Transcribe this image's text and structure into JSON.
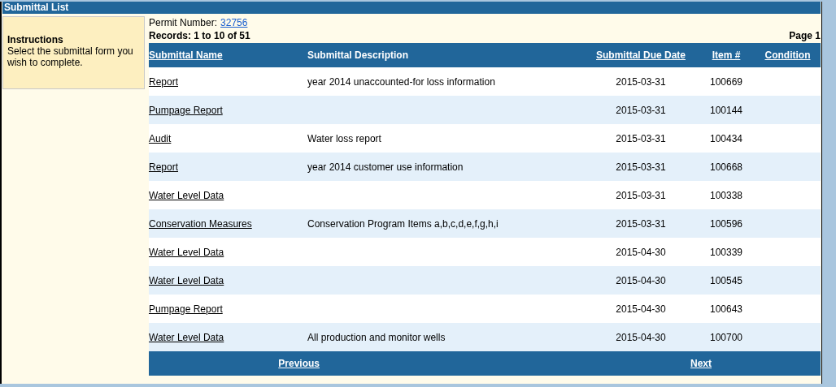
{
  "panel": {
    "title": "Submittal List"
  },
  "instructions": {
    "heading": "Instructions",
    "text": "Select the submittal form you wish to complete."
  },
  "permit": {
    "label": "Permit Number:",
    "number": "32756"
  },
  "records": "Records: 1 to 10 of 51",
  "page": "Page 1",
  "table": {
    "columns": [
      "Submittal Name",
      "Submittal Description",
      "Submittal Due Date",
      "Item #",
      "Condition"
    ],
    "rows": [
      {
        "name": "Report",
        "description": "year 2014 unaccounted-for loss information",
        "due_date": "2015-03-31",
        "item": "100669"
      },
      {
        "name": "Pumpage Report",
        "description": "",
        "due_date": "2015-03-31",
        "item": "100144"
      },
      {
        "name": "Audit",
        "description": "Water loss report",
        "due_date": "2015-03-31",
        "item": "100434"
      },
      {
        "name": "Report",
        "description": "year 2014 customer use information",
        "due_date": "2015-03-31",
        "item": "100668"
      },
      {
        "name": "Water Level Data",
        "description": "",
        "due_date": "2015-03-31",
        "item": "100338"
      },
      {
        "name": "Conservation Measures",
        "description": "Conservation Program Items a,b,c,d,e,f,g,h,i",
        "due_date": "2015-03-31",
        "item": "100596"
      },
      {
        "name": "Water Level Data",
        "description": "",
        "due_date": "2015-04-30",
        "item": "100339"
      },
      {
        "name": "Water Level Data",
        "description": "",
        "due_date": "2015-04-30",
        "item": "100545"
      },
      {
        "name": "Pumpage Report",
        "description": "",
        "due_date": "2015-04-30",
        "item": "100643"
      },
      {
        "name": "Water Level Data",
        "description": "All production and monitor wells",
        "due_date": "2015-04-30",
        "item": "100700"
      }
    ]
  },
  "pager": {
    "previous": "Previous",
    "next": "Next"
  }
}
